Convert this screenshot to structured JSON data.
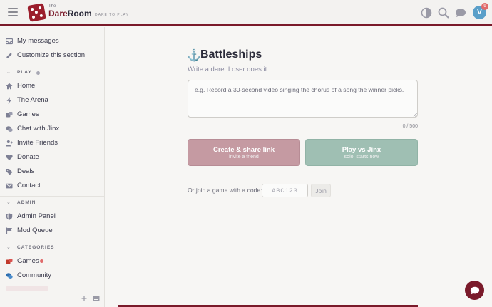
{
  "header": {
    "logo_small": "The",
    "logo_name_1": "Dare",
    "logo_name_2": "Room",
    "tagline": "DARE TO PLAY",
    "avatar_letter": "V",
    "notification_count": "9",
    "icons": [
      "theme-toggle-icon",
      "search-icon",
      "chat-icon"
    ]
  },
  "sidebar": {
    "top_items": [
      {
        "label": "My messages",
        "icon": "inbox-icon"
      },
      {
        "label": "Customize this section",
        "icon": "pencil-icon"
      }
    ],
    "play": {
      "heading": "PLAY",
      "items": [
        {
          "label": "Home",
          "icon": "home-icon"
        },
        {
          "label": "The Arena",
          "icon": "bolt-icon"
        },
        {
          "label": "Games",
          "icon": "dice-icon"
        },
        {
          "label": "Chat with Jinx",
          "icon": "chat-bubbles-icon"
        },
        {
          "label": "Invite Friends",
          "icon": "user-plus-icon"
        },
        {
          "label": "Donate",
          "icon": "heart-icon"
        },
        {
          "label": "Deals",
          "icon": "tag-icon"
        },
        {
          "label": "Contact",
          "icon": "envelope-icon"
        }
      ]
    },
    "admin": {
      "heading": "ADMIN",
      "items": [
        {
          "label": "Admin Panel",
          "icon": "shield-icon"
        },
        {
          "label": "Mod Queue",
          "icon": "flag-icon"
        }
      ]
    },
    "categories": {
      "heading": "CATEGORIES",
      "items": [
        {
          "label": "Games",
          "icon": "dice-icon",
          "color": "#c0392b"
        },
        {
          "label": "Community",
          "icon": "chat-bubbles-icon",
          "color": "#2e6fb0"
        }
      ]
    }
  },
  "main": {
    "title": "Battleships",
    "subtitle": "Write a dare. Loser does it.",
    "dare_placeholder": "e.g. Record a 30-second video singing the chorus of a song the winner picks.",
    "char_count": "0 / 500",
    "create_button": {
      "title": "Create & share link",
      "sub": "invite a friend"
    },
    "play_button": {
      "title": "Play vs Jinx",
      "sub": "solo, starts now"
    },
    "join_label": "Or join a game with a code:",
    "code_placeholder": "ABC123",
    "join_button": "Join"
  },
  "colors": {
    "brand": "#7a1a2a",
    "create_button": "#c59aa2",
    "play_button": "#9fbfb3",
    "avatar": "#5a9fc9",
    "badge": "#e06a6a"
  }
}
